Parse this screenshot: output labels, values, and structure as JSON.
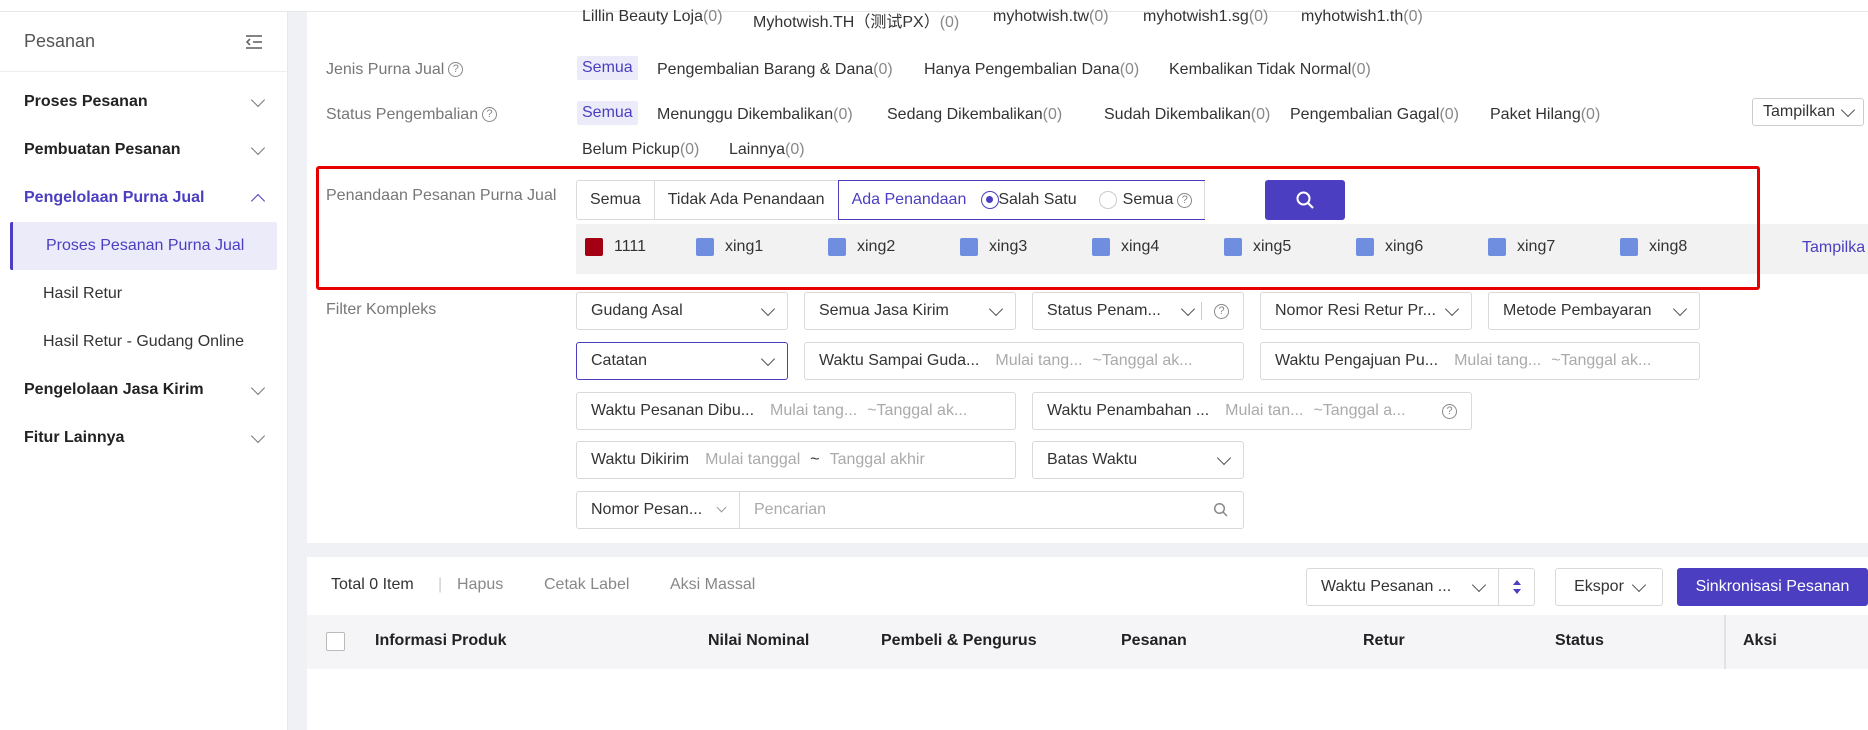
{
  "sidebar": {
    "title": "Pesanan",
    "groups": [
      {
        "label": "Proses Pesanan"
      },
      {
        "label": "Pembuatan Pesanan"
      },
      {
        "label": "Pengelolaan Purna Jual"
      },
      {
        "label": "Pengelolaan Jasa Kirim"
      },
      {
        "label": "Fitur Lainnya"
      }
    ],
    "sub_items": [
      {
        "label": "Proses Pesanan Purna Jual"
      },
      {
        "label": "Hasil Retur"
      },
      {
        "label": "Hasil Retur - Gudang Online"
      }
    ]
  },
  "stores": [
    {
      "name": "Lillin Beauty Loja",
      "count": "(0)"
    },
    {
      "name": "Myhotwish.TH（测试PX）",
      "count": "(0)"
    },
    {
      "name": "myhotwish.tw",
      "count": "(0)"
    },
    {
      "name": "myhotwish1.sg",
      "count": "(0)"
    },
    {
      "name": "myhotwish1.th",
      "count": "(0)"
    }
  ],
  "jenis": {
    "label": "Jenis Purna Jual",
    "active": "Semua",
    "options": [
      {
        "name": "Pengembalian Barang & Dana",
        "count": "(0)"
      },
      {
        "name": "Hanya Pengembalian Dana",
        "count": "(0)"
      },
      {
        "name": "Kembalikan Tidak Normal",
        "count": "(0)"
      }
    ]
  },
  "status": {
    "label": "Status Pengembalian",
    "active": "Semua",
    "options": [
      {
        "name": "Menunggu Dikembalikan",
        "count": "(0)"
      },
      {
        "name": "Sedang Dikembalikan",
        "count": "(0)"
      },
      {
        "name": "Sudah Dikembalikan",
        "count": "(0)"
      },
      {
        "name": "Pengembalian Gagal",
        "count": "(0)"
      },
      {
        "name": "Paket Hilang",
        "count": "(0)"
      },
      {
        "name": "Belum Pickup",
        "count": "(0)"
      },
      {
        "name": "Lainnya",
        "count": "(0)"
      }
    ],
    "tampilkan": "Tampilkan"
  },
  "penandaan": {
    "label": "Penandaan Pesanan Purna Jual",
    "segments": [
      "Semua",
      "Tidak Ada Penandaan",
      "Ada Penandaan"
    ],
    "radio_one": "Salah Satu",
    "radio_all": "Semua",
    "marks": [
      {
        "name": "1111",
        "color": "#a30014"
      },
      {
        "name": "xing1",
        "color": "#6f8ee0"
      },
      {
        "name": "xing2",
        "color": "#6f8ee0"
      },
      {
        "name": "xing3",
        "color": "#6f8ee0"
      },
      {
        "name": "xing4",
        "color": "#6f8ee0"
      },
      {
        "name": "xing5",
        "color": "#6f8ee0"
      },
      {
        "name": "xing6",
        "color": "#6f8ee0"
      },
      {
        "name": "xing7",
        "color": "#6f8ee0"
      },
      {
        "name": "xing8",
        "color": "#6f8ee0"
      }
    ],
    "tampilkan_link": "Tampilka"
  },
  "filter": {
    "label": "Filter Kompleks",
    "gudang": "Gudang Asal",
    "jasa": "Semua Jasa Kirim",
    "status_penam": "Status Penam...",
    "resi": "Nomor Resi Retur Pr...",
    "metode": "Metode Pembayaran",
    "catatan": "Catatan",
    "waktu_sampai": "Waktu Sampai Guda...",
    "waktu_pengajuan": "Waktu Pengajuan Pu...",
    "waktu_pesanan": "Waktu Pesanan Dibu...",
    "waktu_penambahan": "Waktu Penambahan ...",
    "waktu_dikirim": "Waktu Dikirim",
    "batas_waktu": "Batas Waktu",
    "start_1": "Mulai tang...",
    "end_1": "~Tanggal ak...",
    "start_2": "Mulai tang...",
    "end_2": "~Tanggal ak...",
    "start_3": "Mulai tang...",
    "end_3": "~Tanggal ak...",
    "start_4": "Mulai tan...",
    "end_4": "~Tanggal a...",
    "start_5": "Mulai tanggal",
    "tilde": "~",
    "end_5": "Tanggal akhir",
    "nomor_pesanan": "Nomor Pesan...",
    "search_placeholder": "Pencarian"
  },
  "toolbar": {
    "total": "Total 0 Item",
    "hapus": "Hapus",
    "cetak": "Cetak Label",
    "aksi_massal": "Aksi Massal",
    "sort": "Waktu Pesanan ...",
    "ekspor": "Ekspor",
    "sync": "Sinkronisasi Pesanan"
  },
  "table": {
    "headers": [
      "Informasi Produk",
      "Nilai Nominal",
      "Pembeli & Pengurus",
      "Pesanan",
      "Retur",
      "Status",
      "Aksi"
    ]
  },
  "colors": {
    "accent": "#4b3ec0",
    "highlight": "#e60000"
  }
}
